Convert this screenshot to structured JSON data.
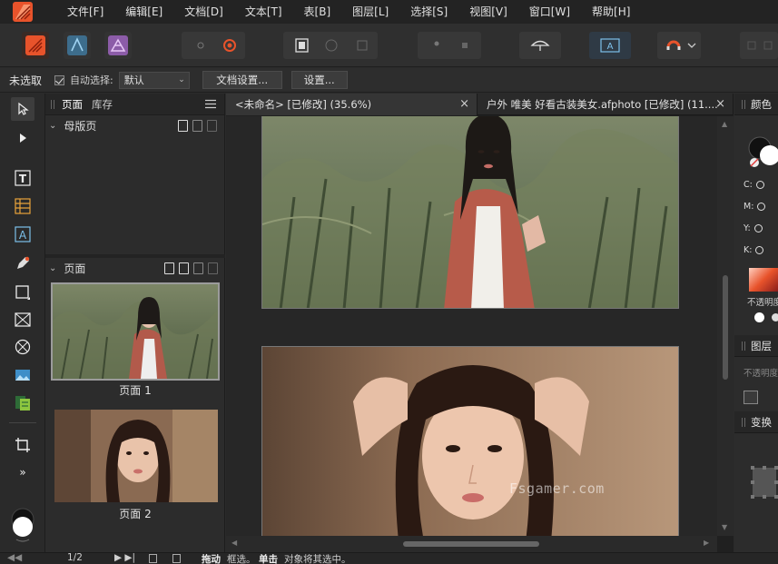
{
  "menu": [
    "文件[F]",
    "编辑[E]",
    "文档[D]",
    "文本[T]",
    "表[B]",
    "图层[L]",
    "选择[S]",
    "视图[V]",
    "窗口[W]",
    "帮助[H]"
  ],
  "context": {
    "selection": "未选取",
    "auto_select_label": "自动选择:",
    "auto_select_value": "默认",
    "doc_setup": "文档设置...",
    "preferences": "设置..."
  },
  "pages_panel": {
    "tabs": [
      "页面",
      "库存"
    ],
    "master_section": "母版页",
    "pages_section": "页面",
    "pages": [
      "页面 1",
      "页面 2"
    ]
  },
  "doc_tabs": [
    {
      "title": "<未命名> [已修改] (35.6%)"
    },
    {
      "title": "户外 唯美 好看古装美女.afphoto [已修改] (11...."
    }
  ],
  "watermark": "Fsgamer.com",
  "right_panel": {
    "color_title": "颜色",
    "channels": [
      "C:",
      "M:",
      "Y:",
      "K:"
    ],
    "opacity_label": "不透明度",
    "layers_title": "图层",
    "layers_opacity": "不透明度",
    "transform_title": "变换"
  },
  "status": {
    "page_counter": "1/2",
    "hint_drag_bold": "拖动",
    "hint_drag": "框选。",
    "hint_click_bold": "单击",
    "hint_click": "对象将其选中。"
  },
  "colors": {
    "accent": "#e8532b",
    "bg": "#2b2b2b",
    "panel": "#2c2c2c"
  }
}
